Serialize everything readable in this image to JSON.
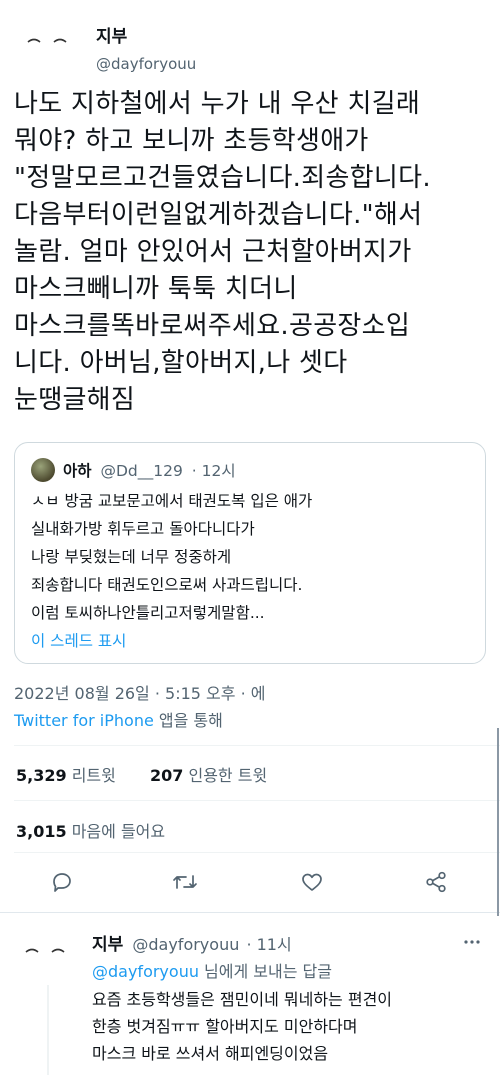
{
  "tweet": {
    "author_name": "지부",
    "author_handle": "@dayforyouu",
    "text": "나도 지하철에서 누가 내 우산 치길래\n뭐야? 하고 보니까 초등학생애가\n\"정말모르고건들였습니다.죄송합니다.\n다음부터이런일없게하겠습니다.\"해서\n놀람. 얼마 안있어서 근처할아버지가\n마스크빼니까 툭툭 치더니\n마스크를똑바로써주세요.공공장소입\n니다. 아버님,할아버지,나 셋다\n눈땡글해짐",
    "quote": {
      "author_name": "아하",
      "author_handle": "@Dd__129",
      "time": "· 12시",
      "text": "ㅅㅂ 방굼 교보문고에서 태권도복 입은 애가\n실내화가방 휘두르고 돌아다니다가\n나랑 부딪혔는데 너무 정중하게\n죄송합니다 태권도인으로써 사과드립니다.\n이럼 토씨하나안틀리고저렇게말함...",
      "show_thread": "이 스레드 표시"
    },
    "timestamp": "2022년 08월 26일 · 5:15 오후 · 에",
    "source_app": "Twitter for iPhone",
    "source_suffix": " 앱을 통해",
    "retweets_count": "5,329",
    "retweets_label": " 리트윗",
    "quotes_count": "207",
    "quotes_label": " 인용한 트윗",
    "likes_count": "3,015",
    "likes_label": " 마음에 들어요"
  },
  "reply": {
    "author_name": "지부",
    "author_handle": "@dayforyouu",
    "time": "· 11시",
    "replying_to": "@dayforyouu",
    "replying_suffix": " 님에게 보내는 답글",
    "text": "요즘 초등학생들은 잼민이네 뭐네하는 편견이\n한층 벗겨짐ㅠㅠ 할아버지도 미안하다며\n마스크 바로 쓰셔서 해피엔딩이었음"
  },
  "icons": {
    "reply": "comment-icon",
    "retweet": "retweet-icon",
    "like": "heart-icon",
    "share": "share-icon",
    "more": "more-icon"
  },
  "colors": {
    "link": "#1d9bf0",
    "muted": "#536471",
    "text": "#0f1419"
  }
}
